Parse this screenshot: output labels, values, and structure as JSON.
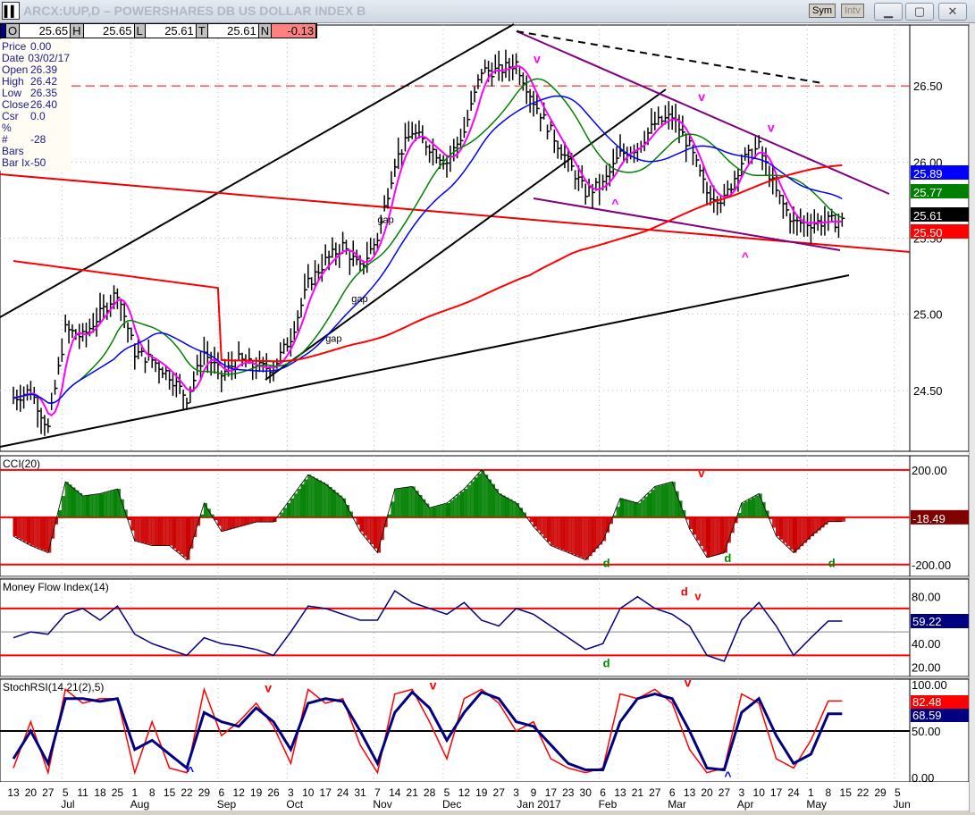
{
  "window": {
    "title": "ARCX:UUP,D – POWERSHARES DB US DOLLAR INDEX B",
    "sym_label": "Sym",
    "intv_label": "Intv",
    "minimize": "▁",
    "restore": "▢",
    "close": "✕",
    "icon": "▌▌"
  },
  "ohlc": {
    "o_label": "O",
    "o": "25.65",
    "h_label": "H",
    "h": "25.65",
    "l_label": "L",
    "l": "25.61",
    "t_label": "T",
    "t": "25.61",
    "n_label": "N",
    "n": "-0.13"
  },
  "info": [
    {
      "k": "Price",
      "v": "0.00"
    },
    {
      "k": "Date",
      "v": "03/02/17"
    },
    {
      "k": "Open",
      "v": "26.39"
    },
    {
      "k": "High",
      "v": "26.42"
    },
    {
      "k": "Low",
      "v": "26.35"
    },
    {
      "k": "Close",
      "v": "26.40"
    },
    {
      "k": "Csr %",
      "v": "0.0"
    },
    {
      "k": "# Bars",
      "v": "-28"
    },
    {
      "k": "Bar Ix",
      "v": "-50"
    }
  ],
  "colors": {
    "price": "#000000",
    "ma_fast": "#ff00ff",
    "ma_mid": "#008000",
    "ma_slow": "#0000ff",
    "ma_long": "#ff0000",
    "trend_purple": "#800080",
    "cci_up": "#008000",
    "cci_down": "#cc0000",
    "mfi": "#000080",
    "stoch_k": "#ff0000",
    "stoch_d": "#000080"
  },
  "chart_data": [
    {
      "type": "line",
      "title": "ARCX:UUP,D",
      "ylim": [
        24.1,
        26.9
      ],
      "yticks": [
        "26.50",
        "26.00",
        "25.50",
        "25.00",
        "24.50"
      ],
      "ytick_values": [
        26.5,
        26.0,
        25.5,
        25.0,
        24.5
      ],
      "x_weeks": [
        "Jun 13",
        "Jun 20",
        "Jun 27",
        "Jul 5",
        "Jul 11",
        "Jul 18",
        "Jul 25",
        "Aug 1",
        "Aug 8",
        "Aug 15",
        "Aug 22",
        "Aug 29",
        "Sep 6",
        "Sep 12",
        "Sep 19",
        "Sep 26",
        "Oct 3",
        "Oct 10",
        "Oct 17",
        "Oct 24",
        "Oct 31",
        "Nov 7",
        "Nov 14",
        "Nov 21",
        "Nov 28",
        "Dec 5",
        "Dec 12",
        "Dec 19",
        "Dec 27",
        "Jan 3",
        "Jan 9",
        "Jan 17",
        "Jan 23",
        "Jan 30",
        "Feb 6",
        "Feb 13",
        "Feb 21",
        "Feb 27",
        "Mar 6",
        "Mar 13",
        "Mar 20",
        "Mar 27",
        "Apr 3",
        "Apr 10",
        "Apr 17",
        "Apr 24",
        "May 1",
        "May 8"
      ],
      "close": [
        24.45,
        24.5,
        24.25,
        24.9,
        24.85,
        25.0,
        25.15,
        24.75,
        24.7,
        24.6,
        24.45,
        24.75,
        24.6,
        24.7,
        24.65,
        24.65,
        24.85,
        25.2,
        25.35,
        25.45,
        25.3,
        25.5,
        26.0,
        26.2,
        26.1,
        26.0,
        26.2,
        26.6,
        26.6,
        26.65,
        26.4,
        26.2,
        26.0,
        25.8,
        25.85,
        26.05,
        26.1,
        26.25,
        26.3,
        26.1,
        25.8,
        25.75,
        26.0,
        26.1,
        25.8,
        25.6,
        25.6,
        25.61
      ],
      "last_values": [
        {
          "label": "25.89",
          "color": "#0000ff"
        },
        {
          "label": "25.77",
          "color": "#008000"
        },
        {
          "label": "25.61",
          "color": "#000000"
        },
        {
          "label": "25.50",
          "color": "#ff0000"
        }
      ],
      "resistance_line": 26.5,
      "annotations": [
        {
          "text": "gap",
          "week": 19.5,
          "price": 25.08
        },
        {
          "text": "gap",
          "week": 18,
          "price": 24.82
        },
        {
          "text": "gap",
          "week": 21,
          "price": 25.6
        },
        {
          "text": "v",
          "week": 30,
          "price": 26.65
        },
        {
          "text": "v",
          "week": 39.5,
          "price": 26.4
        },
        {
          "text": "v",
          "week": 43.5,
          "price": 26.2
        },
        {
          "text": "^",
          "week": 34.5,
          "price": 25.7
        },
        {
          "text": "^",
          "week": 42,
          "price": 25.35
        }
      ]
    },
    {
      "type": "bar",
      "title": "CCI(20)",
      "ylim": [
        -250,
        260
      ],
      "yticks": [
        "200.00",
        "-200.00"
      ],
      "ytick_values": [
        200,
        -200
      ],
      "last": "-18.49",
      "values": [
        -80,
        -120,
        -150,
        150,
        90,
        100,
        120,
        -100,
        -120,
        -120,
        -180,
        60,
        -60,
        -40,
        -20,
        -20,
        80,
        180,
        140,
        80,
        -60,
        -150,
        120,
        130,
        40,
        60,
        120,
        200,
        100,
        60,
        -40,
        -120,
        -150,
        -180,
        -100,
        80,
        60,
        130,
        150,
        -50,
        -170,
        -150,
        60,
        100,
        -80,
        -150,
        -80,
        -18.49
      ],
      "annotations": [
        {
          "text": "d",
          "week": 34,
          "value": -210
        },
        {
          "text": "d",
          "week": 41,
          "value": -190
        },
        {
          "text": "d",
          "week": 47,
          "value": -210
        },
        {
          "text": "v",
          "week": 39.5,
          "value": 170
        }
      ]
    },
    {
      "type": "line",
      "title": "Money Flow Index(14)",
      "ylim": [
        12,
        95
      ],
      "yticks": [
        "80.00",
        "40.00",
        "20.00"
      ],
      "ytick_values": [
        80,
        40,
        20
      ],
      "bands": [
        70,
        30
      ],
      "last": "59.22",
      "values": [
        45,
        50,
        48,
        65,
        70,
        60,
        72,
        48,
        40,
        35,
        30,
        45,
        40,
        38,
        35,
        30,
        50,
        72,
        70,
        65,
        60,
        60,
        85,
        75,
        70,
        65,
        75,
        60,
        55,
        70,
        65,
        55,
        45,
        35,
        40,
        70,
        80,
        70,
        65,
        55,
        30,
        25,
        60,
        75,
        55,
        30,
        45,
        59.22
      ],
      "annotations": [
        {
          "text": "d",
          "week": 34,
          "value": 20
        },
        {
          "text": "d",
          "week": 38.5,
          "value": 81
        },
        {
          "text": "v",
          "week": 39.3,
          "value": 77
        }
      ]
    },
    {
      "type": "line",
      "title": "StochRSI(14,21(2),5)",
      "ylim": [
        -5,
        106
      ],
      "yticks": [
        "100.00",
        "50.00",
        "0.00"
      ],
      "ytick_values": [
        100,
        50,
        0
      ],
      "midline": 50,
      "last_k": "82.48",
      "last_d": "68.59",
      "k": [
        10,
        60,
        5,
        95,
        80,
        85,
        85,
        5,
        60,
        10,
        5,
        95,
        45,
        60,
        80,
        55,
        15,
        95,
        80,
        85,
        35,
        5,
        90,
        95,
        60,
        20,
        85,
        95,
        80,
        50,
        60,
        20,
        10,
        5,
        10,
        90,
        85,
        95,
        80,
        30,
        5,
        10,
        90,
        80,
        20,
        10,
        40,
        82.48
      ],
      "d": [
        20,
        50,
        15,
        85,
        85,
        82,
        85,
        30,
        40,
        25,
        10,
        70,
        60,
        55,
        75,
        60,
        30,
        80,
        85,
        82,
        50,
        15,
        70,
        92,
        75,
        40,
        70,
        92,
        85,
        60,
        55,
        35,
        15,
        8,
        8,
        60,
        85,
        90,
        85,
        50,
        10,
        8,
        70,
        85,
        45,
        15,
        25,
        68.59
      ],
      "annotations": [
        {
          "text": "v",
          "week": 14.5,
          "value": 92
        },
        {
          "text": "v",
          "week": 24,
          "value": 95
        },
        {
          "text": "v",
          "week": 38.7,
          "value": 98
        },
        {
          "text": "^",
          "week": 10,
          "value": 2
        },
        {
          "text": "^",
          "week": 41,
          "value": -3
        }
      ]
    }
  ],
  "xaxis": {
    "days": [
      "13",
      "20",
      "27",
      "5",
      "11",
      "18",
      "25",
      "1",
      "8",
      "15",
      "22",
      "29",
      "6",
      "12",
      "19",
      "26",
      "3",
      "10",
      "17",
      "24",
      "31",
      "7",
      "14",
      "21",
      "28",
      "5",
      "12",
      "19",
      "27",
      "3",
      "9",
      "17",
      "23",
      "30",
      "6",
      "13",
      "21",
      "27",
      "6",
      "13",
      "20",
      "27",
      "3",
      "10",
      "17",
      "24",
      "1",
      "8",
      "15",
      "22",
      "29",
      "5"
    ],
    "months": [
      {
        "label": "Jul",
        "week": 3
      },
      {
        "label": "Aug",
        "week": 7
      },
      {
        "label": "Sep",
        "week": 12
      },
      {
        "label": "Oct",
        "week": 16
      },
      {
        "label": "Nov",
        "week": 21
      },
      {
        "label": "Dec",
        "week": 25
      },
      {
        "label": "Jan 2017",
        "week": 29.3
      },
      {
        "label": "Feb",
        "week": 34
      },
      {
        "label": "Mar",
        "week": 38
      },
      {
        "label": "Apr",
        "week": 42
      },
      {
        "label": "May",
        "week": 46
      },
      {
        "label": "Jun",
        "week": 51
      }
    ]
  }
}
